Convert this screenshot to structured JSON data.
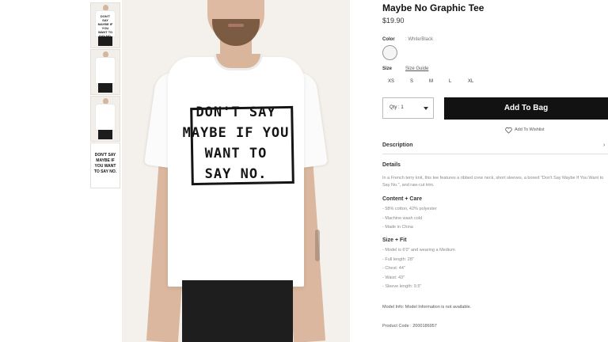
{
  "gallery": {
    "main_print": [
      "DON'T SAY",
      "MAYBE IF YOU",
      "WANT TO",
      "SAY NO."
    ],
    "thumb_print": "DON'T SAY MAYBE IF YOU WANT TO SAY NO."
  },
  "product": {
    "title": "Maybe No Graphic Tee",
    "price": "$19.90",
    "color_label": "Color",
    "color_value": ": White/Black",
    "swatch_color": "#f5f5f5",
    "size_label": "Size",
    "size_guide": "Size Guide",
    "sizes": [
      "XS",
      "S",
      "M",
      "L",
      "XL"
    ],
    "qty_label": "Qty : 1",
    "add_to_bag": "Add To Bag",
    "wishlist": "Add To Wishlist"
  },
  "description": {
    "header": "Description",
    "details_title": "Details",
    "details_text": "In a French terry knit, this tee features a ribbed crew neck, short sleeves, a boxed \"Don't Say Maybe If You Want to Say No.\", and raw-cut trim.",
    "content_title": "Content + Care",
    "content_items": [
      "- 58% cotton, 42% polyester",
      "- Machine wash cold",
      "- Made in China"
    ],
    "fit_title": "Size + Fit",
    "fit_items": [
      "- Model is 6'0\" and wearing a Medium",
      "- Full length: 28\"",
      "- Chest: 44\"",
      "- Waist: 43\"",
      "- Sleeve length: 9.5\""
    ],
    "model_info": "Model Info: Model Information is not available.",
    "product_code": "Product Code : 2000186957"
  }
}
